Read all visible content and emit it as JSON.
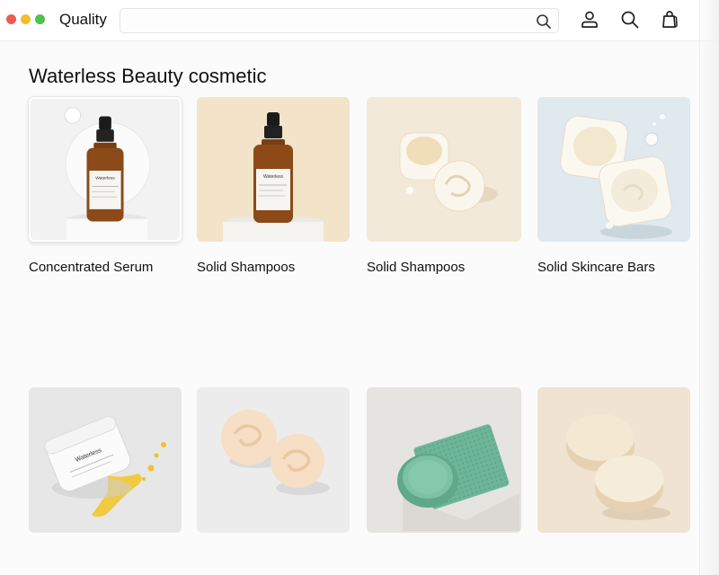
{
  "window": {
    "controls": [
      "close",
      "minimize",
      "maximize"
    ]
  },
  "header": {
    "brand": "Quality",
    "search": {
      "value": "",
      "placeholder": ""
    },
    "icons": [
      "search-icon",
      "account-icon",
      "search-icon",
      "shopping-bag-icon"
    ]
  },
  "section": {
    "title": "Waterless Beauty cosmetic"
  },
  "products": [
    {
      "label": "Concentrated Serum",
      "bottle_text": "Waterless",
      "bg": "#f2f2f2",
      "image": "serum-bottle-bubble"
    },
    {
      "label": "Solid Shampoos",
      "bottle_text": "Waterless",
      "bg": "#f3e3c9",
      "image": "serum-bottle-pedestal"
    },
    {
      "label": "Solid Shampoos",
      "bg": "#f3e9d8",
      "image": "cream-jars"
    },
    {
      "label": "Solid Skincare Bars",
      "bg": "#dfe9ee",
      "image": "square-cream-bars"
    },
    {
      "label": "",
      "jar_text": "Waterless",
      "bg": "#e7e7e7",
      "image": "cream-jar-oil"
    },
    {
      "label": "",
      "bg": "#ececec",
      "image": "swirl-bars"
    },
    {
      "label": "",
      "bg": "#e6e4e0",
      "image": "green-sponge-bar"
    },
    {
      "label": "",
      "bg": "#f0e3d1",
      "image": "round-shampoo-bars"
    }
  ],
  "colors": {
    "accent_red": "#ee5a52",
    "accent_yellow": "#f5bd2b",
    "accent_green": "#4dc34a"
  }
}
